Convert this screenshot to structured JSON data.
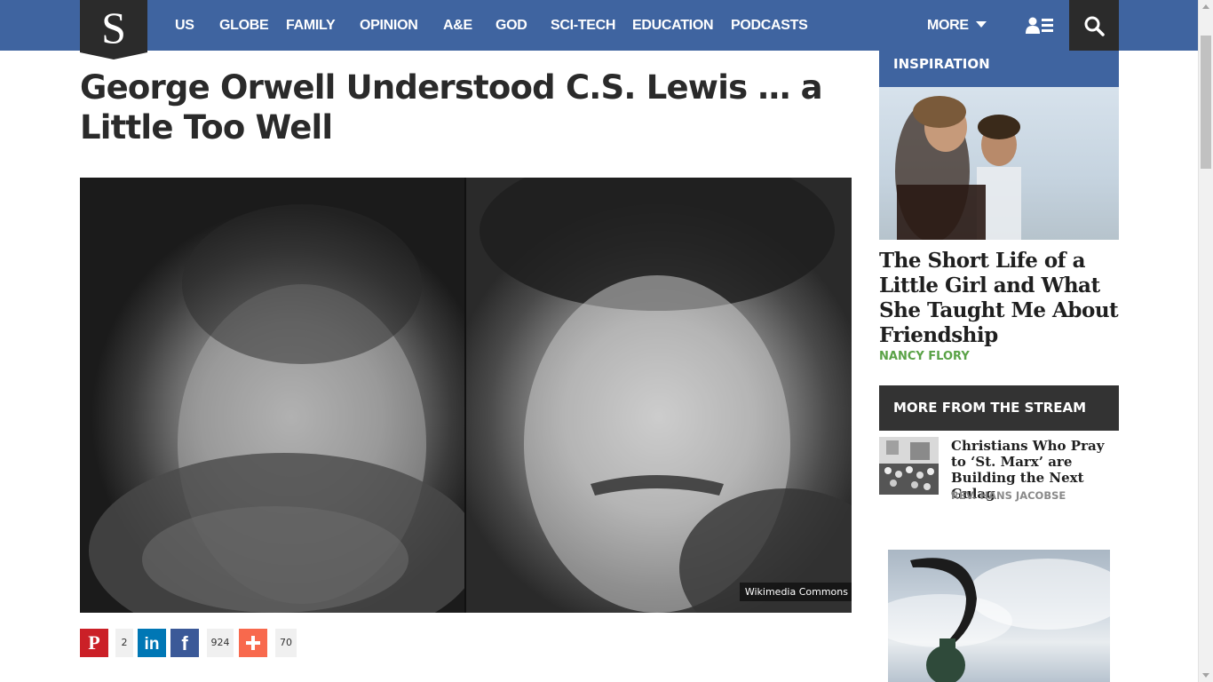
{
  "nav": {
    "logo": "S",
    "items": [
      "US",
      "GLOBE",
      "FAMILY",
      "OPINION",
      "A&E",
      "GOD",
      "SCI-TECH",
      "EDUCATION",
      "PODCASTS"
    ],
    "more": "MORE",
    "user_icon": "user-list-icon",
    "search_icon": "search-icon",
    "color": "#3f64a0"
  },
  "article": {
    "title": "George Orwell Understood C.S. Lewis … a Little Too Well",
    "image_credit": "Wikimedia Commons",
    "share": {
      "pinterest_count": "2",
      "facebook_count": "924",
      "more_count": "70"
    }
  },
  "sidebar": {
    "inspiration": {
      "heading": "INSPIRATION",
      "title": "The Short Life of a Little Girl and What She Taught Me About Friendship",
      "author": "NANCY FLORY"
    },
    "stream": {
      "heading": "MORE FROM THE STREAM",
      "title": "Christians Who Pray to ‘St. Marx’ are Building the Next Gulag",
      "author": "REV. HANS JACOBSE"
    }
  },
  "colors": {
    "nav_blue": "#3f64a0",
    "dark": "#2b2b2b",
    "author_green": "#5aa247",
    "pinterest": "#cb2027",
    "linkedin": "#0077b5",
    "facebook": "#3b5998",
    "addthis": "#f8694d"
  }
}
